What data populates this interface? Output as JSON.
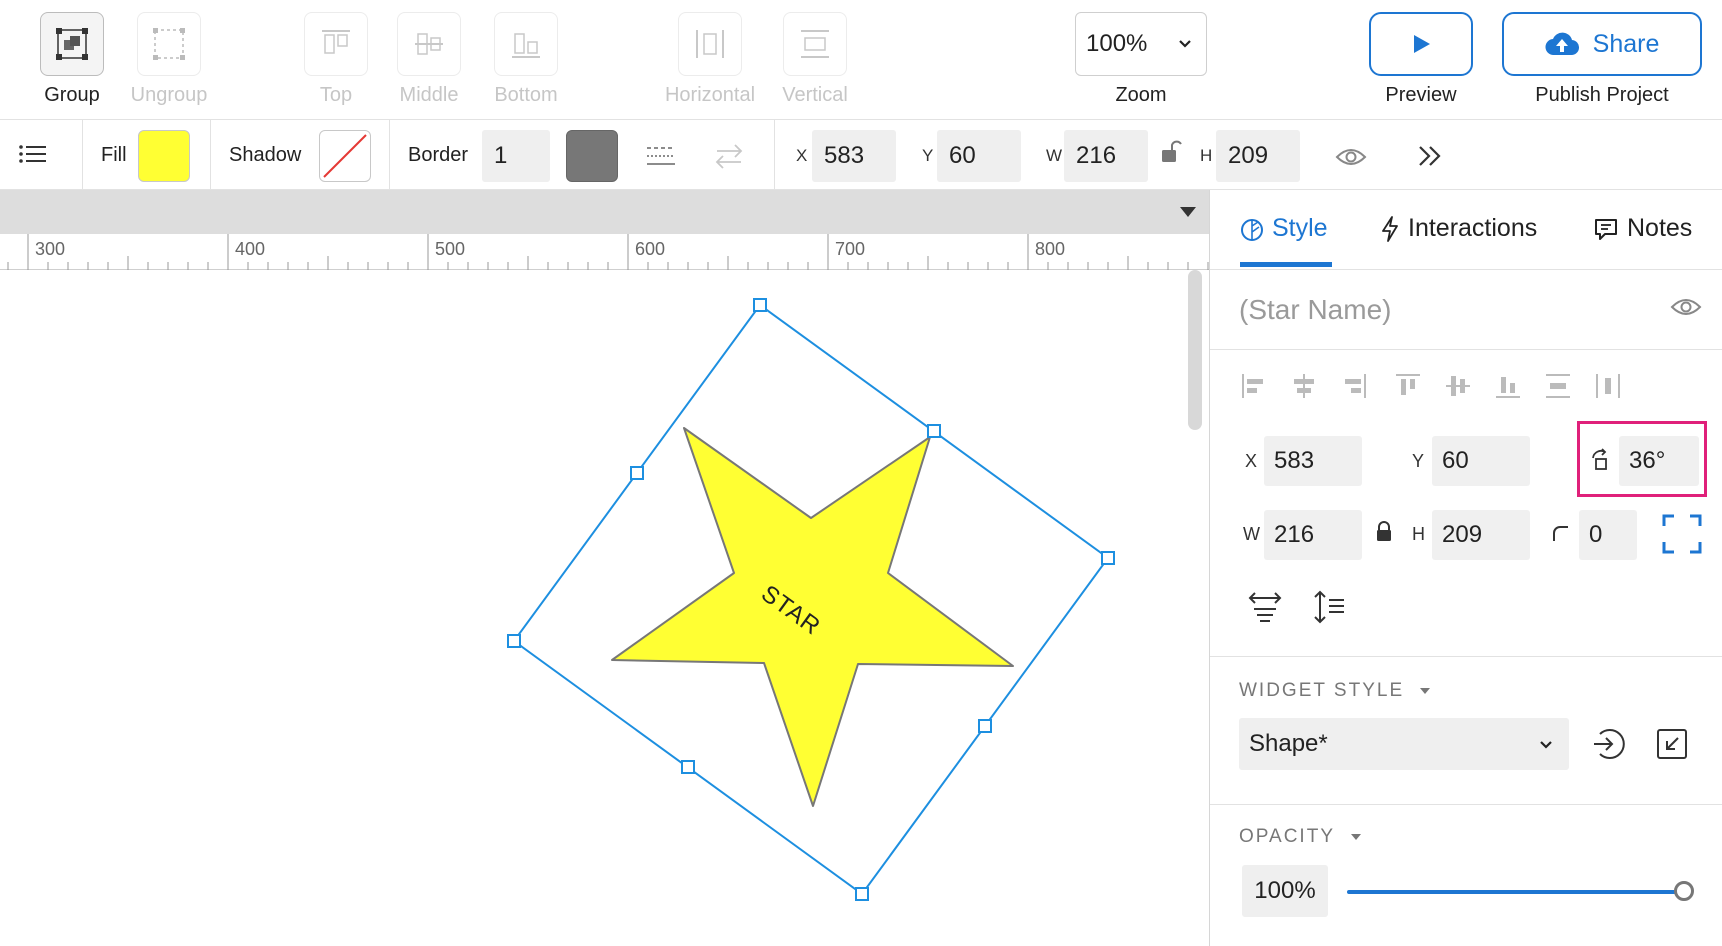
{
  "toolbar": {
    "group": "Group",
    "ungroup": "Ungroup",
    "top": "Top",
    "middle": "Middle",
    "bottom": "Bottom",
    "horizontal": "Horizontal",
    "vertical": "Vertical",
    "zoom_value": "100%",
    "zoom_label": "Zoom",
    "preview_label": "Preview",
    "share_label": "Share",
    "publish_label": "Publish Project"
  },
  "stylebar": {
    "fill_label": "Fill",
    "fill_color": "#ffff33",
    "shadow_label": "Shadow",
    "border_label": "Border",
    "border_value": "1",
    "border_color": "#777777",
    "x_label": "X",
    "x_value": "583",
    "y_label": "Y",
    "y_value": "60",
    "w_label": "W",
    "w_value": "216",
    "h_label": "H",
    "h_value": "209"
  },
  "ruler": {
    "labels": [
      "300",
      "400",
      "500",
      "600",
      "700",
      "800"
    ]
  },
  "canvas": {
    "shape_text": "STAR",
    "selection_color": "#1d8fe0",
    "star_fill": "#ffff33"
  },
  "panel": {
    "tabs": {
      "style": "Style",
      "interactions": "Interactions",
      "notes": "Notes"
    },
    "name_placeholder": "(Star Name)",
    "x_label": "X",
    "x_value": "583",
    "y_label": "Y",
    "y_value": "60",
    "rotation_value": "36°",
    "w_label": "W",
    "w_value": "216",
    "h_label": "H",
    "h_value": "209",
    "corner_value": "0",
    "widget_style_title": "WIDGET STYLE",
    "widget_style_value": "Shape*",
    "opacity_title": "OPACITY",
    "opacity_value": "100%",
    "opacity_level": 1.0
  },
  "colors": {
    "accent": "#1d76d2",
    "highlight": "#e0207a"
  }
}
